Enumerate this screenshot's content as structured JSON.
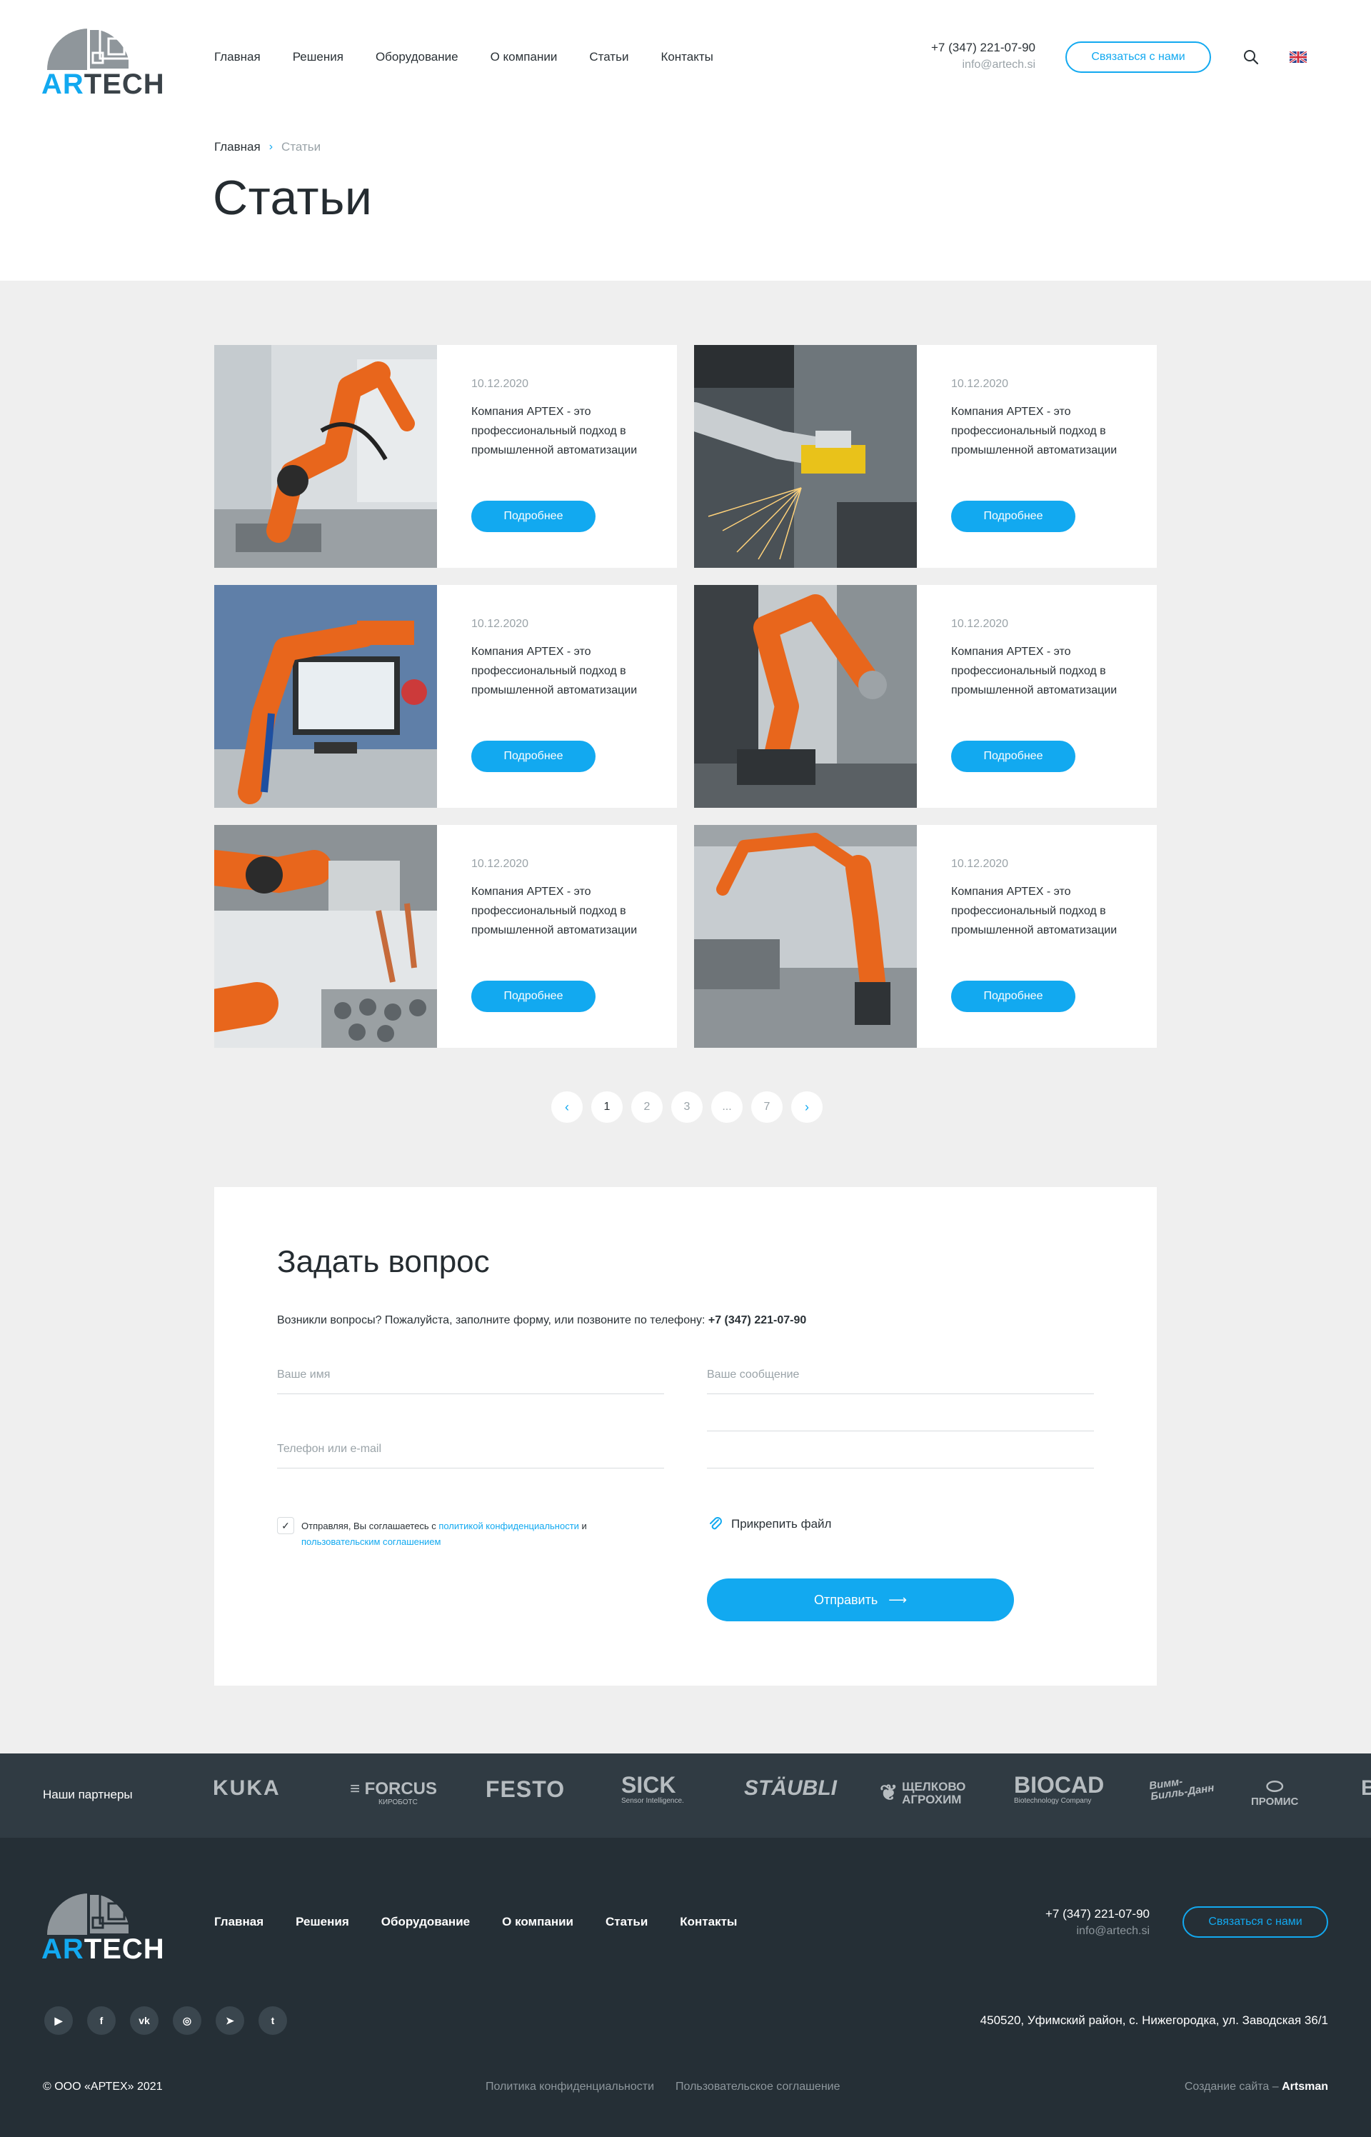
{
  "brand": {
    "part1": "AR",
    "part2": "TECH"
  },
  "nav": [
    {
      "label": "Главная"
    },
    {
      "label": "Решения"
    },
    {
      "label": "Оборудование"
    },
    {
      "label": "О компании"
    },
    {
      "label": "Статьи"
    },
    {
      "label": "Контакты"
    }
  ],
  "contact": {
    "phone": "+7 (347) 221-07-90",
    "email": "info@artech.si"
  },
  "cta_label": "Связаться с нами",
  "breadcrumb": {
    "home": "Главная",
    "current": "Статьи"
  },
  "page_title": "Статьи",
  "articles": [
    {
      "date": "10.12.2020",
      "text": "Компания АРТЕХ - это профессиональный подход в промышленной автоматизации",
      "button": "Подробнее"
    },
    {
      "date": "10.12.2020",
      "text": "Компания АРТЕХ - это профессиональный подход в промышленной автоматизации",
      "button": "Подробнее"
    },
    {
      "date": "10.12.2020",
      "text": "Компания АРТЕХ - это профессиональный подход в промышленной автоматизации",
      "button": "Подробнее"
    },
    {
      "date": "10.12.2020",
      "text": "Компания АРТЕХ - это профессиональный подход в промышленной автоматизации",
      "button": "Подробнее"
    },
    {
      "date": "10.12.2020",
      "text": "Компания АРТЕХ - это профессиональный подход в промышленной автоматизации",
      "button": "Подробнее"
    },
    {
      "date": "10.12.2020",
      "text": "Компания АРТЕХ - это профессиональный подход в промышленной автоматизации",
      "button": "Подробнее"
    }
  ],
  "pagination": {
    "prev": "‹",
    "pages": [
      "1",
      "2",
      "3",
      "...",
      "7"
    ],
    "next": "›",
    "current": "1"
  },
  "form": {
    "title": "Задать вопрос",
    "description": "Возникли вопросы? Пожалуйста, заполните форму, или позвоните по телефону: ",
    "phone": "+7 (347) 221-07-90",
    "name_placeholder": "Ваше имя",
    "contact_placeholder": "Телефон или e-mail",
    "message_placeholder": "Ваше сообщение",
    "agree_prefix": "Отправляя, Вы соглашаетесь с ",
    "agree_link1": "политикой конфиденциальности",
    "agree_mid": " и ",
    "agree_link2": "пользовательским соглашением",
    "attach_label": "Прикрепить файл",
    "submit_label": "Отправить"
  },
  "partners": {
    "label": "Наши партнеры",
    "logos": [
      {
        "name": "KUKA",
        "sub": ""
      },
      {
        "name": "FORCUS",
        "sub": "КИРОБОТС"
      },
      {
        "name": "FESTO",
        "sub": ""
      },
      {
        "name": "SICK",
        "sub": "Sensor Intelligence."
      },
      {
        "name": "STÄUBLI",
        "sub": ""
      },
      {
        "name": "ЩЕЛКОВО АГРОХИМ",
        "sub": ""
      },
      {
        "name": "BIOCAD",
        "sub": "Biotechnology Company"
      },
      {
        "name": "Вимм-Билль-Данн",
        "sub": ""
      },
      {
        "name": "ПРОМИС",
        "sub": ""
      },
      {
        "name": "B",
        "sub": ""
      }
    ]
  },
  "footer": {
    "socials": [
      "youtube-icon",
      "facebook-icon",
      "vk-icon",
      "instagram-icon",
      "telegram-icon",
      "twitter-icon"
    ],
    "address": "450520, Уфимский район, с. Нижегородка, ул. Заводская 36/1",
    "copyright": "© ООО «АРТЕХ» 2021",
    "privacy": "Политика конфиденциальности",
    "terms": "Пользовательское соглашение",
    "made_prefix": "Создание сайта – ",
    "made_by": "Artsman"
  },
  "colors": {
    "accent": "#12a9f0",
    "dark": "#252f36",
    "partners_bg": "#303b43",
    "grey_bg": "#efefef",
    "robot_orange": "#e8661c"
  }
}
